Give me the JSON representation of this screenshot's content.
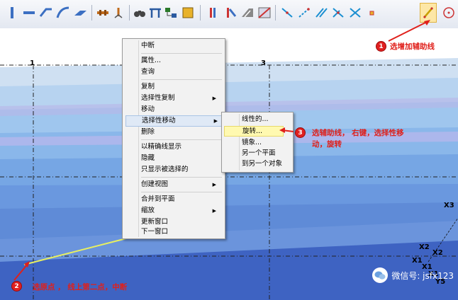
{
  "toolbar": {
    "icons": [
      "column-icon",
      "beam-icon",
      "brace-icon",
      "curved-beam-icon",
      "plate-icon",
      "bolt-icon",
      "weld-icon",
      "binoculars-icon",
      "measure-icon",
      "hierarchy-icon",
      "box-icon",
      "column-seq-icon",
      "column-seq2-icon",
      "section-icon",
      "view-icon",
      "point-line-icon",
      "point-dashed-icon",
      "parallel-line-icon",
      "intersect-icon",
      "cross-icon",
      "point-small-icon",
      "add-construction-line-icon",
      "circle-point-icon"
    ],
    "selected": "add-construction-line-icon"
  },
  "grid": {
    "labels": [
      "1",
      "3"
    ],
    "right_labels": [
      "X3",
      "X2",
      "X2",
      "X1",
      "X1",
      "X1",
      "Y5"
    ]
  },
  "context_menu": {
    "items": [
      {
        "label": "中断"
      },
      {
        "sep": true
      },
      {
        "label": "属性..."
      },
      {
        "label": "查询"
      },
      {
        "sep": true
      },
      {
        "label": "复制"
      },
      {
        "label": "选择性复制",
        "arrow": "▶"
      },
      {
        "label": "移动"
      },
      {
        "label": "选择性移动",
        "arrow": "▶",
        "highlight": true
      },
      {
        "label": "删除"
      },
      {
        "sep": true
      },
      {
        "label": "以精确线显示"
      },
      {
        "label": "隐藏"
      },
      {
        "label": "只显示被选择的"
      },
      {
        "sep": true
      },
      {
        "label": "创建视图",
        "arrow": "▶"
      },
      {
        "sep": true
      },
      {
        "label": "合并到平面"
      },
      {
        "label": "缩放",
        "arrow": "▶"
      },
      {
        "label": "更新窗口"
      },
      {
        "label": "下一窗口"
      }
    ]
  },
  "submenu": {
    "items": [
      {
        "label": "线性的..."
      },
      {
        "label": "旋转...",
        "highlight": true
      },
      {
        "label": "镜象..."
      },
      {
        "label": "另一个平面"
      },
      {
        "label": "到另一个对象"
      }
    ]
  },
  "annotations": {
    "a1": {
      "num": "1",
      "text": "选增加辅助线"
    },
    "a2": {
      "num": "2",
      "text": "选原点 ， 线上第二点，中断"
    },
    "a3": {
      "num": "3",
      "text_line1": "选辅助线， 右键，选择性移",
      "text_line2": "动，旋转"
    }
  },
  "watermark": {
    "text": "微信号: jsfx123"
  },
  "colors": {
    "annotation": "#e0201b",
    "highlight_menu": "#dfe9f6",
    "highlight_sub": "#fff9b0",
    "selected_tool": "#fde7a6"
  }
}
